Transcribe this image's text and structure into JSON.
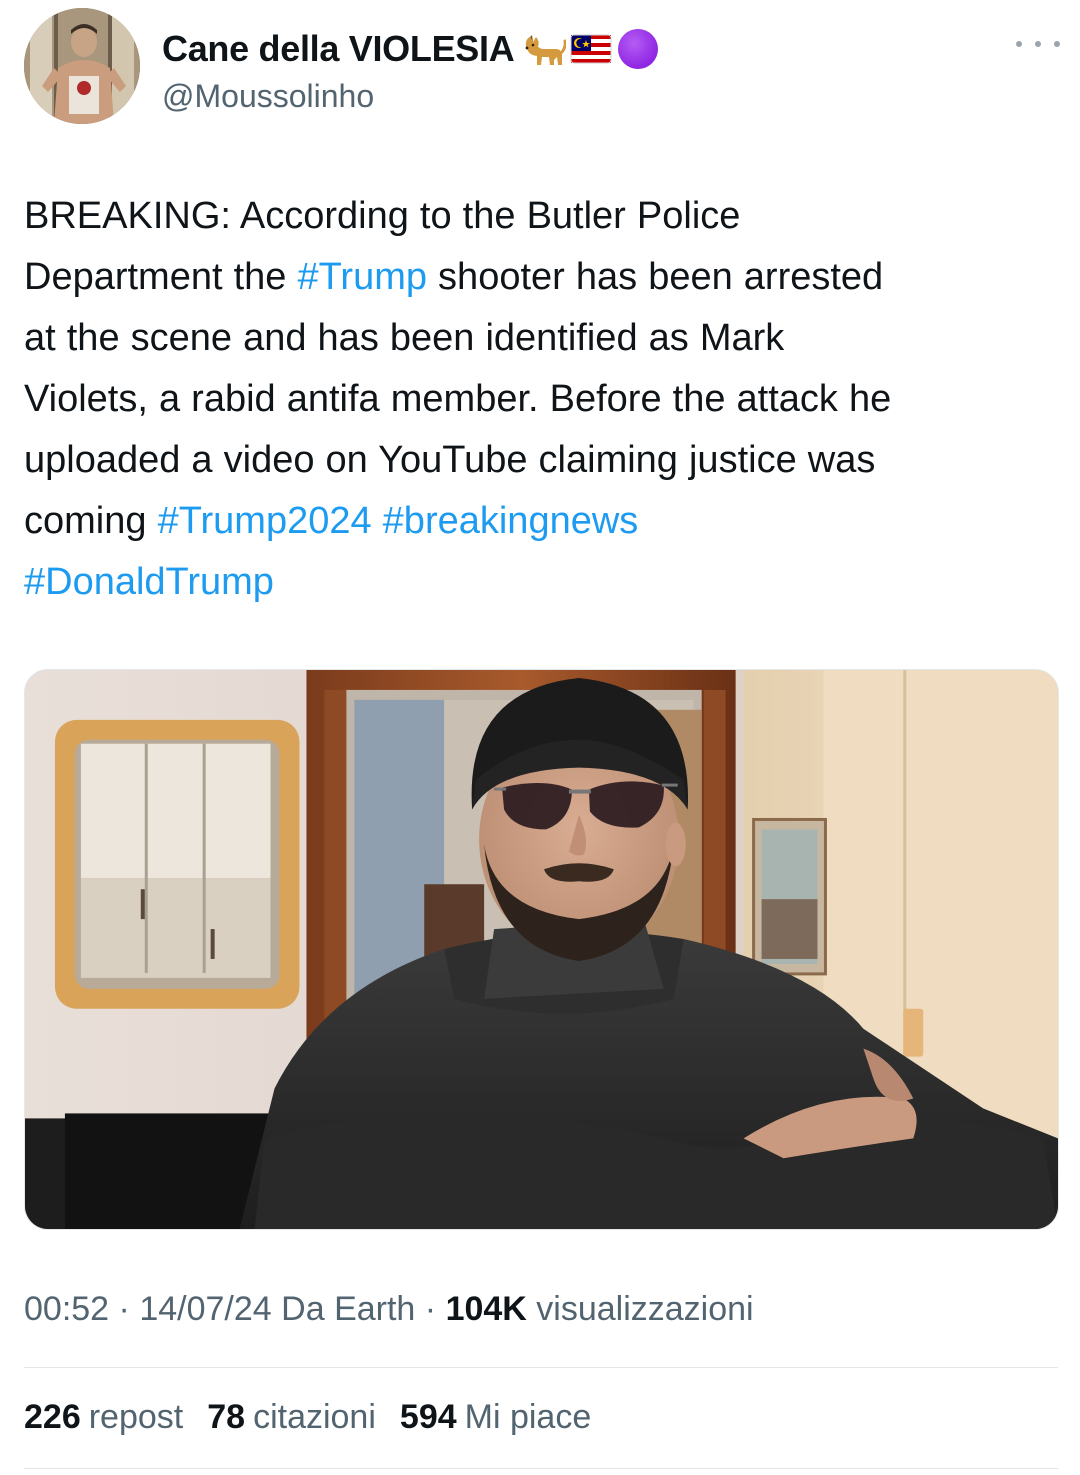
{
  "author": {
    "display_name": "Cane della VIOLESIA",
    "handle": "@Moussolinho",
    "badges": [
      "dog-emoji",
      "malaysia-flag-emoji",
      "purple-circle-emoji"
    ]
  },
  "tweet": {
    "segments": [
      {
        "type": "text",
        "value": "BREAKING: According to the Butler Police"
      },
      {
        "type": "break"
      },
      {
        "type": "text",
        "value": "Department the "
      },
      {
        "type": "hashtag",
        "value": "#Trump"
      },
      {
        "type": "text",
        "value": " shooter has been arrested"
      },
      {
        "type": "break"
      },
      {
        "type": "text",
        "value": "at the scene and has been identified as Mark"
      },
      {
        "type": "break"
      },
      {
        "type": "text",
        "value": "Violets, a rabid antifa member. Before the attack he"
      },
      {
        "type": "break"
      },
      {
        "type": "text",
        "value": "uploaded a video on YouTube claiming justice was"
      },
      {
        "type": "break"
      },
      {
        "type": "text",
        "value": "coming "
      },
      {
        "type": "hashtag",
        "value": "#Trump2024"
      },
      {
        "type": "text",
        "value": " "
      },
      {
        "type": "hashtag",
        "value": "#breakingnews"
      },
      {
        "type": "break"
      },
      {
        "type": "hashtag",
        "value": "#DonaldTrump"
      }
    ],
    "media": {
      "kind": "photo"
    }
  },
  "meta": {
    "time": "00:52",
    "date": "14/07/24",
    "source_prefix": "Da",
    "source": "Earth",
    "separator": "·",
    "views_count": "104K",
    "views_label": "visualizzazioni"
  },
  "stats": [
    {
      "count": "226",
      "label": "repost"
    },
    {
      "count": "78",
      "label": "citazioni"
    },
    {
      "count": "594",
      "label": "Mi piace"
    }
  ],
  "colors": {
    "link": "#1d9bf0",
    "text": "#0f1419",
    "secondary": "#536471",
    "badge_purple": "#9b33e6"
  }
}
